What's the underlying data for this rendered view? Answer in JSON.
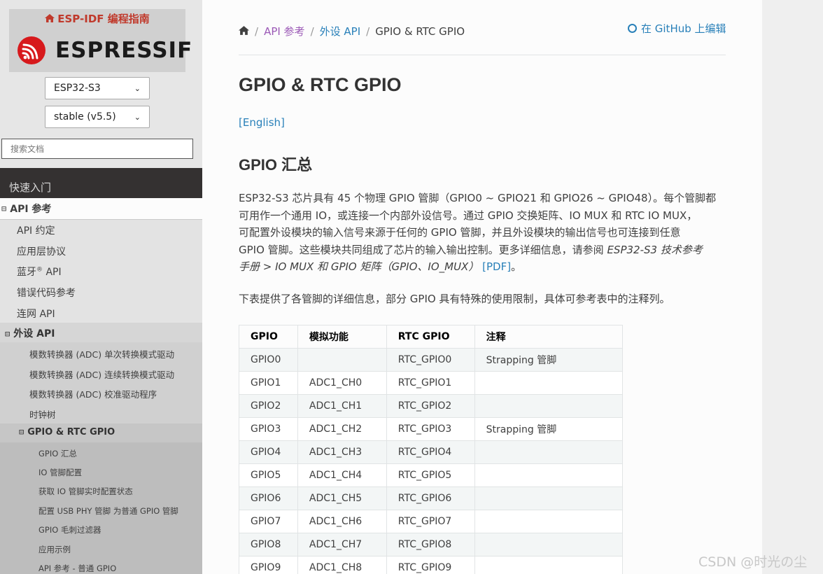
{
  "sidebar": {
    "brand_title": "ESP-IDF 编程指南",
    "logo_text": "ESPRESSIF",
    "target_select": "ESP32-S3",
    "version_select": "stable (v5.5)",
    "search_placeholder": "搜索文档",
    "nav": {
      "quick_start": "快速入门",
      "api_reference": "API 参考",
      "api_children": [
        "API 约定",
        "应用层协议",
        "蓝牙",
        "错误代码参考",
        "连网 API"
      ],
      "bluetooth_sup": "®",
      "bluetooth_suffix": " API",
      "peripherals": "外设 API",
      "peripherals_children": [
        "模数转换器 (ADC) 单次转换模式驱动",
        "模数转换器 (ADC) 连续转换模式驱动",
        "模数转换器 (ADC) 校准驱动程序",
        "时钟树"
      ],
      "gpio": "GPIO & RTC GPIO",
      "gpio_children": [
        "GPIO 汇总",
        "IO 管脚配置",
        "获取 IO 管脚实时配置状态",
        "配置 USB PHY 管脚 为普通 GPIO 管脚",
        "GPIO 毛刺过滤器",
        "应用示例",
        "API 参考 - 普通 GPIO"
      ],
      "toggle_glyph": "⊟"
    }
  },
  "breadcrumb": {
    "home_icon": "home-icon",
    "items": [
      "API 参考",
      "外设 API",
      "GPIO & RTC GPIO"
    ],
    "separator": "/"
  },
  "github_link": "在 GitHub 上编辑",
  "page": {
    "title": "GPIO & RTC GPIO",
    "english_link": "[English]",
    "section_title": "GPIO 汇总",
    "paragraph": {
      "line1": "ESP32-S3 芯片具有 45 个物理 GPIO 管脚（GPIO0 ~ GPIO21 和 GPIO26 ~ GPIO48）。每个管脚都",
      "line2": "可用作一个通用 IO，或连接一个内部外设信号。通过 GPIO 交换矩阵、IO MUX 和 RTC IO MUX，",
      "line3": "可配置外设模块的输入信号来源于任何的 GPIO 管脚，并且外设模块的输出信号也可连接到任意",
      "line4_text": "GPIO 管脚。这些模块共同组成了芯片的输入输出控制。更多详细信息，请参阅 ",
      "line4_em": "ESP32-S3 技术参考",
      "line5_em": "手册 > IO MUX 和 GPIO 矩阵（GPIO、IO_MUX）",
      "line5_space": " ",
      "line5_link": "[PDF]",
      "line5_end": "。"
    },
    "paragraph2": "下表提供了各管脚的详细信息，部分 GPIO 具有特殊的使用限制，具体可参考表中的注释列。"
  },
  "table": {
    "headers": [
      "GPIO",
      "模拟功能",
      "RTC GPIO",
      "注释"
    ],
    "rows": [
      [
        "GPIO0",
        "",
        "RTC_GPIO0",
        "Strapping 管脚"
      ],
      [
        "GPIO1",
        "ADC1_CH0",
        "RTC_GPIO1",
        ""
      ],
      [
        "GPIO2",
        "ADC1_CH1",
        "RTC_GPIO2",
        ""
      ],
      [
        "GPIO3",
        "ADC1_CH2",
        "RTC_GPIO3",
        "Strapping 管脚"
      ],
      [
        "GPIO4",
        "ADC1_CH3",
        "RTC_GPIO4",
        ""
      ],
      [
        "GPIO5",
        "ADC1_CH4",
        "RTC_GPIO5",
        ""
      ],
      [
        "GPIO6",
        "ADC1_CH5",
        "RTC_GPIO6",
        ""
      ],
      [
        "GPIO7",
        "ADC1_CH6",
        "RTC_GPIO7",
        ""
      ],
      [
        "GPIO8",
        "ADC1_CH7",
        "RTC_GPIO8",
        ""
      ],
      [
        "GPIO9",
        "ADC1_CH8",
        "RTC_GPIO9",
        ""
      ]
    ]
  },
  "watermark": "CSDN @时光の尘",
  "colors": {
    "link": "#2980b9",
    "visited_link": "#9b59b6",
    "brand_red": "#c0392b",
    "sidebar_dark": "#343131"
  }
}
